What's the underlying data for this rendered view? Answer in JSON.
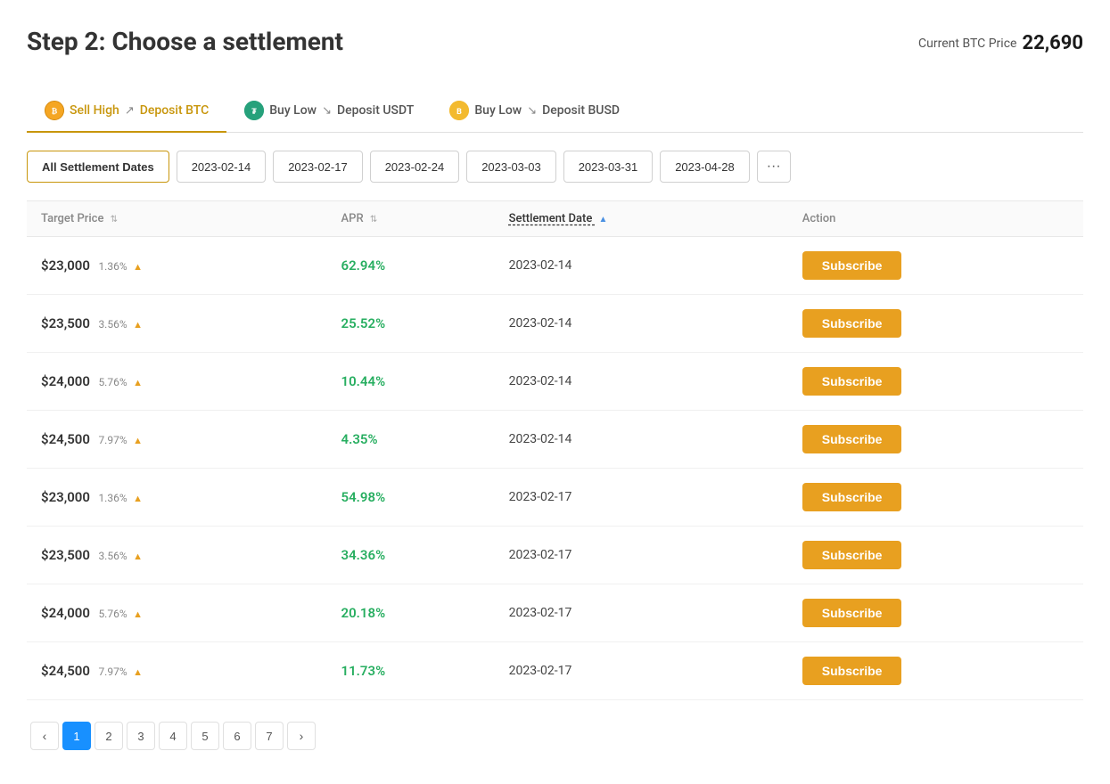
{
  "header": {
    "title": "Step 2: Choose a settlement",
    "btc_price_label": "Current BTC Price",
    "btc_price_value": "22,690"
  },
  "tabs": [
    {
      "id": "sell-high",
      "label": "Sell High",
      "deposit": "Deposit BTC",
      "icon": "SH",
      "type": "sell",
      "arrow": "up",
      "active": true
    },
    {
      "id": "buy-low-usdt",
      "label": "Buy Low",
      "deposit": "Deposit USDT",
      "icon": "BL",
      "type": "buy-usdt",
      "arrow": "down",
      "active": false
    },
    {
      "id": "buy-low-busd",
      "label": "Buy Low",
      "deposit": "Deposit BUSD",
      "icon": "BL",
      "type": "buy-busd",
      "arrow": "down",
      "active": false
    }
  ],
  "date_filters": [
    {
      "label": "All Settlement Dates",
      "active": true
    },
    {
      "label": "2023-02-14",
      "active": false
    },
    {
      "label": "2023-02-17",
      "active": false
    },
    {
      "label": "2023-02-24",
      "active": false
    },
    {
      "label": "2023-03-03",
      "active": false
    },
    {
      "label": "2023-03-31",
      "active": false
    },
    {
      "label": "2023-04-28",
      "active": false
    },
    {
      "label": "...",
      "active": false
    }
  ],
  "table": {
    "columns": [
      {
        "label": "Target Price",
        "sortable": true,
        "active": false
      },
      {
        "label": "APR",
        "sortable": true,
        "active": false
      },
      {
        "label": "Settlement Date",
        "sortable": true,
        "active": true
      },
      {
        "label": "Action",
        "sortable": false,
        "active": false
      }
    ],
    "rows": [
      {
        "target_price": "$23,000",
        "percent": "1.36%",
        "apr": "62.94%",
        "settlement_date": "2023-02-14",
        "action": "Subscribe"
      },
      {
        "target_price": "$23,500",
        "percent": "3.56%",
        "apr": "25.52%",
        "settlement_date": "2023-02-14",
        "action": "Subscribe"
      },
      {
        "target_price": "$24,000",
        "percent": "5.76%",
        "apr": "10.44%",
        "settlement_date": "2023-02-14",
        "action": "Subscribe"
      },
      {
        "target_price": "$24,500",
        "percent": "7.97%",
        "apr": "4.35%",
        "settlement_date": "2023-02-14",
        "action": "Subscribe"
      },
      {
        "target_price": "$23,000",
        "percent": "1.36%",
        "apr": "54.98%",
        "settlement_date": "2023-02-17",
        "action": "Subscribe"
      },
      {
        "target_price": "$23,500",
        "percent": "3.56%",
        "apr": "34.36%",
        "settlement_date": "2023-02-17",
        "action": "Subscribe"
      },
      {
        "target_price": "$24,000",
        "percent": "5.76%",
        "apr": "20.18%",
        "settlement_date": "2023-02-17",
        "action": "Subscribe"
      },
      {
        "target_price": "$24,500",
        "percent": "7.97%",
        "apr": "11.73%",
        "settlement_date": "2023-02-17",
        "action": "Subscribe"
      }
    ]
  },
  "pagination": {
    "prev_label": "‹",
    "next_label": "›",
    "current": 1,
    "pages": [
      1,
      2,
      3,
      4,
      5,
      6,
      7
    ]
  }
}
